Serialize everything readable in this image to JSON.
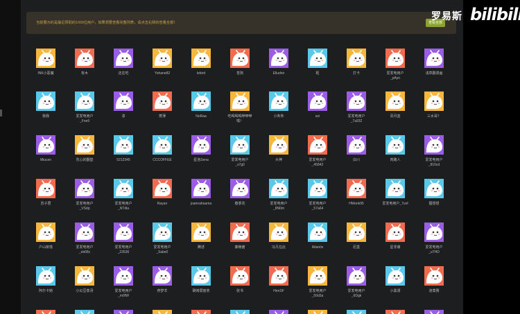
{
  "notice": {
    "text": "当前展示的是最近赞助的1000位用户，如果想要查看完整列表，请点击右侧的查看全部！",
    "button_label": "查看全部"
  },
  "watermark": {
    "text_cn": "罗易斯",
    "logo": "bilibili"
  },
  "colors": {
    "panel_bg": "#1d1e20",
    "notice_bg": "#36322a",
    "notice_text": "#c9a24a",
    "button_bg": "#8aa232",
    "avatar_tiles": [
      "#f6b73c",
      "#f26b4f",
      "#9b5de5",
      "#5ac8e8"
    ]
  },
  "avatar_icon": "tv-mascot-icon",
  "users": [
    [
      {
        "name": "INK小恶魔",
        "c": 0
      },
      {
        "name": "有木",
        "c": 1
      },
      {
        "name": "还在吃",
        "c": 2
      },
      {
        "name": "Yohane82",
        "c": 0
      },
      {
        "name": "lebird",
        "c": 0
      },
      {
        "name": "苍狗",
        "c": 1
      },
      {
        "name": "Elludnir",
        "c": 2
      },
      {
        "name": "枢",
        "c": 3
      },
      {
        "name": "打卡",
        "c": 0
      },
      {
        "name": "爱发电用户\n_pAyn",
        "c": 1
      },
      {
        "name": "浅草翻漫画",
        "c": 2
      }
    ],
    [
      {
        "name": "我我",
        "c": 3
      },
      {
        "name": "爱发电用户\n_Fne9",
        "c": 3
      },
      {
        "name": "漆",
        "c": 2
      },
      {
        "name": "菱薄",
        "c": 1
      },
      {
        "name": "NoRaa",
        "c": 3
      },
      {
        "name": "吃喝喝喝咿咿咿\n嘿！",
        "c": 0
      },
      {
        "name": "小朱朱",
        "c": 3
      },
      {
        "name": "sei",
        "c": 2
      },
      {
        "name": "爱发电用户\n_7a932",
        "c": 2
      },
      {
        "name": "责月蓝",
        "c": 0
      },
      {
        "name": "三水哥？",
        "c": 0
      }
    ],
    [
      {
        "name": "Miucen",
        "c": 2
      },
      {
        "name": "花心的翻垫",
        "c": 0
      },
      {
        "name": "5212345",
        "c": 3
      },
      {
        "name": "CCCOFFEE",
        "c": 3
      },
      {
        "name": "星洛Sena",
        "c": 2
      },
      {
        "name": "爱发电用户\n_s7g0",
        "c": 3
      },
      {
        "name": "大神",
        "c": 0
      },
      {
        "name": "爱发电用户\n_45842",
        "c": 1
      },
      {
        "name": "白川",
        "c": 2
      },
      {
        "name": "肉路人",
        "c": 3
      },
      {
        "name": "爱发电用户\n_810cd",
        "c": 2
      }
    ],
    [
      {
        "name": "苏子君",
        "c": 1
      },
      {
        "name": "爱发电用户\n_VSdp",
        "c": 2
      },
      {
        "name": "爱发电用户\n_NTdla",
        "c": 3
      },
      {
        "name": "Rayan",
        "c": 1
      },
      {
        "name": "joannahuama",
        "c": 2
      },
      {
        "name": "春季花",
        "c": 2
      },
      {
        "name": "爱发电用户\n_8N0m",
        "c": 3
      },
      {
        "name": "爱发电用户\n_57a64",
        "c": 3
      },
      {
        "name": "HMonk95",
        "c": 1
      },
      {
        "name": "爱发电用户_7uvf",
        "c": 3
      },
      {
        "name": "狸想想",
        "c": 3
      }
    ],
    [
      {
        "name": "户山柳落",
        "c": 0
      },
      {
        "name": "爱发电用户\n_eb68c",
        "c": 2
      },
      {
        "name": "爱发电用户\n_23536",
        "c": 2
      },
      {
        "name": "爱发电用户\n_5abe0",
        "c": 3
      },
      {
        "name": "腾述",
        "c": 0
      },
      {
        "name": "秦楠酱",
        "c": 1
      },
      {
        "name": "冯凡在此",
        "c": 0
      },
      {
        "name": "Atlantis",
        "c": 3
      },
      {
        "name": "尼墨",
        "c": 0
      },
      {
        "name": "星非痛",
        "c": 1
      },
      {
        "name": "爱发电用户\n_uTHD",
        "c": 2
      }
    ],
    [
      {
        "name": "阿尔卡她",
        "c": 3
      },
      {
        "name": "小瓜豆蒸汤",
        "c": 0
      },
      {
        "name": "爱发电用户\n_m0fW",
        "c": 2
      },
      {
        "name": "燕梦羊",
        "c": 2
      },
      {
        "name": "碳烤弱窗羔",
        "c": 3
      },
      {
        "name": "张书",
        "c": 1
      },
      {
        "name": "HenSF",
        "c": 1
      },
      {
        "name": "爱发电用户\n_50d3a",
        "c": 0
      },
      {
        "name": "爱发电用户\n_6Dgk",
        "c": 2
      },
      {
        "name": "小黑漫",
        "c": 3
      },
      {
        "name": "洛蒿赛",
        "c": 1
      }
    ],
    [
      {
        "name": "",
        "c": 1
      },
      {
        "name": "",
        "c": 3
      },
      {
        "name": "",
        "c": 2
      },
      {
        "name": "",
        "c": 0
      },
      {
        "name": "",
        "c": 1
      },
      {
        "name": "",
        "c": 3
      },
      {
        "name": "",
        "c": 2
      },
      {
        "name": "",
        "c": 0
      },
      {
        "name": "",
        "c": 3
      },
      {
        "name": "",
        "c": 1
      },
      {
        "name": "",
        "c": 2
      }
    ]
  ]
}
